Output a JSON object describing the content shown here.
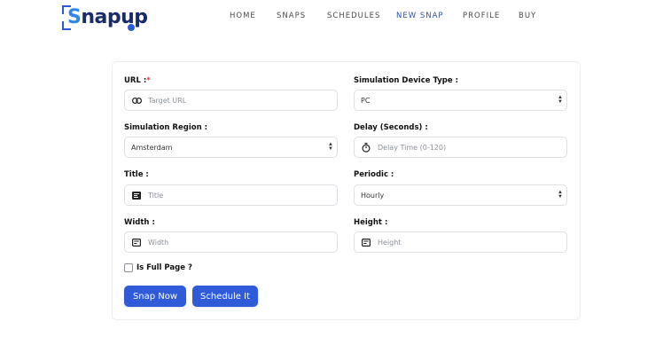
{
  "brand": {
    "name_s": "S",
    "name_rest": "napup",
    "accent": "#2a5bd7"
  },
  "nav": {
    "items": [
      {
        "label": "HOME"
      },
      {
        "label": "SNAPS"
      },
      {
        "label": "SCHEDULES"
      },
      {
        "label": "NEW SNAP"
      },
      {
        "label": "PROFILE"
      },
      {
        "label": "BUY"
      }
    ],
    "active_index": 3
  },
  "form": {
    "url": {
      "label": "URL :",
      "required": "*",
      "placeholder": "Target URL",
      "icon": "link-icon"
    },
    "device_type": {
      "label": "Simulation Device Type :",
      "value": "PC"
    },
    "region": {
      "label": "Simulation Region :",
      "value": "Amsterdam"
    },
    "delay": {
      "label": "Delay (Seconds) :",
      "placeholder": "Delay Time (0-120)",
      "icon": "stopwatch-icon"
    },
    "title": {
      "label": "Title :",
      "placeholder": "Title",
      "icon": "title-icon"
    },
    "periodic": {
      "label": "Periodic :",
      "value": "Hourly"
    },
    "width": {
      "label": "Width :",
      "placeholder": "Width",
      "icon": "dimension-icon"
    },
    "height": {
      "label": "Height :",
      "placeholder": "Height",
      "icon": "dimension-icon"
    },
    "full_page": {
      "label": "Is Full Page ?",
      "checked": false
    }
  },
  "actions": {
    "snap_now": "Snap Now",
    "schedule_it": "Schedule It"
  },
  "colors": {
    "primary": "#2f5bd9",
    "nav_active": "#2d4fa8",
    "required": "#e03131"
  }
}
